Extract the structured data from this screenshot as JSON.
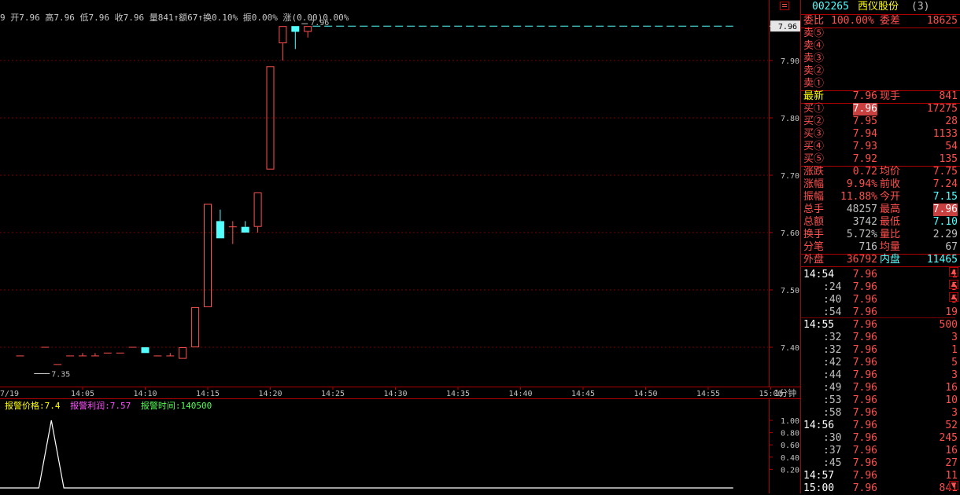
{
  "header": {
    "quote_line": "9 开7.96 高7.96 低7.96 收7.96 量841↑额67↑换0.10% 振0.00% 涨(0.00)0.00%"
  },
  "chart_data": {
    "type": "candlestick",
    "ylim": [
      7.32,
      8.0
    ],
    "y_ticks": [
      "7.90",
      "7.80",
      "7.70",
      "7.60",
      "7.50",
      "7.40"
    ],
    "y_tick_values": [
      7.9,
      7.8,
      7.7,
      7.6,
      7.5,
      7.4
    ],
    "x_ticks": [
      "7/19",
      "14:05",
      "14:10",
      "14:15",
      "14:20",
      "14:25",
      "14:30",
      "14:35",
      "14:40",
      "14:45",
      "14:50",
      "14:55",
      "15:00",
      "1分钟"
    ],
    "x_tick_minutes": [
      0,
      5,
      10,
      15,
      20,
      25,
      30,
      35,
      40,
      45,
      50,
      55,
      60
    ],
    "current_price_label": "7.96",
    "current_price": 7.96,
    "current_price_tag": "7.96",
    "low_annotation": "7.35",
    "low_annotation_value": 7.35,
    "low_annotation_minute": 2.5,
    "candles": [
      {
        "m": 0,
        "o": 7.385,
        "h": 7.385,
        "l": 7.385,
        "c": 7.385
      },
      {
        "m": 2,
        "o": 7.4,
        "h": 7.4,
        "l": 7.4,
        "c": 7.4
      },
      {
        "m": 3,
        "o": 7.37,
        "h": 7.37,
        "l": 7.37,
        "c": 7.37
      },
      {
        "m": 4,
        "o": 7.385,
        "h": 7.385,
        "l": 7.385,
        "c": 7.385
      },
      {
        "m": 5,
        "o": 7.385,
        "h": 7.39,
        "l": 7.385,
        "c": 7.385
      },
      {
        "m": 6,
        "o": 7.385,
        "h": 7.39,
        "l": 7.385,
        "c": 7.385
      },
      {
        "m": 7,
        "o": 7.39,
        "h": 7.39,
        "l": 7.39,
        "c": 7.39
      },
      {
        "m": 8,
        "o": 7.39,
        "h": 7.39,
        "l": 7.39,
        "c": 7.39
      },
      {
        "m": 9,
        "o": 7.4,
        "h": 7.4,
        "l": 7.4,
        "c": 7.4
      },
      {
        "m": 10,
        "o": 7.4,
        "h": 7.4,
        "l": 7.39,
        "c": 7.39
      },
      {
        "m": 11,
        "o": 7.385,
        "h": 7.385,
        "l": 7.385,
        "c": 7.385
      },
      {
        "m": 12,
        "o": 7.385,
        "h": 7.39,
        "l": 7.385,
        "c": 7.385
      },
      {
        "m": 13,
        "o": 7.38,
        "h": 7.4,
        "l": 7.38,
        "c": 7.4
      },
      {
        "m": 14,
        "o": 7.4,
        "h": 7.47,
        "l": 7.4,
        "c": 7.47
      },
      {
        "m": 15,
        "o": 7.47,
        "h": 7.65,
        "l": 7.47,
        "c": 7.65
      },
      {
        "m": 16,
        "o": 7.62,
        "h": 7.64,
        "l": 7.59,
        "c": 7.59
      },
      {
        "m": 17,
        "o": 7.61,
        "h": 7.62,
        "l": 7.58,
        "c": 7.61
      },
      {
        "m": 18,
        "o": 7.61,
        "h": 7.62,
        "l": 7.6,
        "c": 7.6
      },
      {
        "m": 19,
        "o": 7.61,
        "h": 7.67,
        "l": 7.6,
        "c": 7.67
      },
      {
        "m": 20,
        "o": 7.71,
        "h": 7.89,
        "l": 7.71,
        "c": 7.89
      },
      {
        "m": 21,
        "o": 7.93,
        "h": 7.96,
        "l": 7.9,
        "c": 7.96
      },
      {
        "m": 22,
        "o": 7.96,
        "h": 7.96,
        "l": 7.92,
        "c": 7.95
      },
      {
        "m": 23,
        "o": 7.95,
        "h": 7.96,
        "l": 7.94,
        "c": 7.96
      }
    ],
    "sub_ylim": [
      0,
      1.25
    ],
    "sub_y_ticks": [
      "1.00",
      "0.80",
      "0.60",
      "0.40",
      "0.20"
    ],
    "sub_y_tick_values": [
      1.0,
      0.8,
      0.6,
      0.4,
      0.2
    ],
    "alert_series": {
      "x_minutes": [
        -3,
        1.5,
        2.5,
        3.5,
        57
      ],
      "values": [
        0,
        0,
        1,
        0,
        0
      ]
    }
  },
  "alert": {
    "price_label": "报警价格:7.4",
    "profit_label": "报警利润:7.57",
    "time_label": "报警时间:140500"
  },
  "panel": {
    "code": "002265",
    "name": "西仪股份",
    "count": "(3)",
    "weibi_label": "委比",
    "weibi_value": "100.00%",
    "weicha_label": "委差",
    "weicha_value": "18625",
    "sells": [
      {
        "label": "卖⑤",
        "price": "",
        "vol": ""
      },
      {
        "label": "卖④",
        "price": "",
        "vol": ""
      },
      {
        "label": "卖③",
        "price": "",
        "vol": ""
      },
      {
        "label": "卖②",
        "price": "",
        "vol": ""
      },
      {
        "label": "卖①",
        "price": "",
        "vol": ""
      }
    ],
    "latest_label": "最新",
    "latest_value": "7.96",
    "xianshou_label": "现手",
    "xianshou_value": "841",
    "buys": [
      {
        "label": "买①",
        "price": "7.96",
        "vol": "17275"
      },
      {
        "label": "买②",
        "price": "7.95",
        "vol": "28"
      },
      {
        "label": "买③",
        "price": "7.94",
        "vol": "1133"
      },
      {
        "label": "买④",
        "price": "7.93",
        "vol": "54"
      },
      {
        "label": "买⑤",
        "price": "7.92",
        "vol": "135"
      }
    ],
    "stats": [
      {
        "l1": "涨跌",
        "v1": "0.72",
        "l2": "均价",
        "v2": "7.75"
      },
      {
        "l1": "涨幅",
        "v1": "9.94%",
        "l2": "前收",
        "v2": "7.24"
      },
      {
        "l1": "振幅",
        "v1": "11.88%",
        "l2": "今开",
        "v2": "7.15"
      },
      {
        "l1": "总手",
        "v1": "48257",
        "l2": "最高",
        "v2": "7.96"
      },
      {
        "l1": "总额",
        "v1": "3742",
        "l2": "最低",
        "v2": "7.10"
      },
      {
        "l1": "换手",
        "v1": "5.72%",
        "l2": "量比",
        "v2": "2.29"
      },
      {
        "l1": "分笔",
        "v1": "716",
        "l2": "均量",
        "v2": "67"
      }
    ],
    "waipan_label": "外盘",
    "waipan_value": "36792",
    "neipan_label": "内盘",
    "neipan_value": "11465",
    "ticks": [
      {
        "time": "14:54",
        "price": "7.96",
        "vol": "1",
        "major": true
      },
      {
        "time": ":24",
        "price": "7.96",
        "vol": "5",
        "major": false
      },
      {
        "time": ":40",
        "price": "7.96",
        "vol": "5",
        "major": false
      },
      {
        "time": ":54",
        "price": "7.96",
        "vol": "19",
        "major": false
      },
      {
        "time": "14:55",
        "price": "7.96",
        "vol": "500",
        "major": true
      },
      {
        "time": ":32",
        "price": "7.96",
        "vol": "3",
        "major": false
      },
      {
        "time": ":32",
        "price": "7.96",
        "vol": "1",
        "major": false
      },
      {
        "time": ":42",
        "price": "7.96",
        "vol": "5",
        "major": false
      },
      {
        "time": ":44",
        "price": "7.96",
        "vol": "3",
        "major": false
      },
      {
        "time": ":49",
        "price": "7.96",
        "vol": "16",
        "major": false
      },
      {
        "time": ":53",
        "price": "7.96",
        "vol": "10",
        "major": false
      },
      {
        "time": ":58",
        "price": "7.96",
        "vol": "3",
        "major": false
      },
      {
        "time": "14:56",
        "price": "7.96",
        "vol": "52",
        "major": true
      },
      {
        "time": ":30",
        "price": "7.96",
        "vol": "245",
        "major": false
      },
      {
        "time": ":37",
        "price": "7.96",
        "vol": "16",
        "major": false
      },
      {
        "time": ":45",
        "price": "7.96",
        "vol": "27",
        "major": false
      },
      {
        "time": "14:57",
        "price": "7.96",
        "vol": "11",
        "major": true
      },
      {
        "time": "15:00",
        "price": "7.96",
        "vol": "841",
        "major": true
      }
    ]
  },
  "colors": {
    "up": "#ff5050",
    "down": "#54ffff",
    "grid": "#7a0000",
    "axis": "#b00000",
    "label": "#c0c0c0",
    "yellow": "#ffff00",
    "value_red": "#ff5050"
  }
}
